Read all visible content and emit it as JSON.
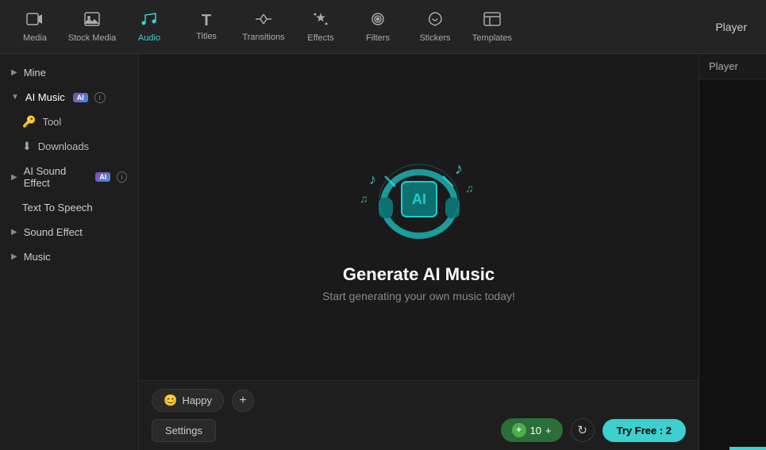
{
  "nav": {
    "items": [
      {
        "id": "media",
        "label": "Media",
        "icon": "🎬",
        "active": false
      },
      {
        "id": "stock-media",
        "label": "Stock Media",
        "icon": "📷",
        "active": false
      },
      {
        "id": "audio",
        "label": "Audio",
        "icon": "♫",
        "active": true
      },
      {
        "id": "titles",
        "label": "Titles",
        "icon": "T",
        "active": false
      },
      {
        "id": "transitions",
        "label": "Transitions",
        "icon": "↔",
        "active": false
      },
      {
        "id": "effects",
        "label": "Effects",
        "icon": "✦",
        "active": false
      },
      {
        "id": "filters",
        "label": "Filters",
        "icon": "◉",
        "active": false
      },
      {
        "id": "stickers",
        "label": "Stickers",
        "icon": "✿",
        "active": false
      },
      {
        "id": "templates",
        "label": "Templates",
        "icon": "⊞",
        "active": false
      }
    ],
    "player_label": "Player"
  },
  "sidebar": {
    "mine_label": "Mine",
    "ai_music_label": "AI Music",
    "tool_label": "Tool",
    "downloads_label": "Downloads",
    "ai_sound_effect_label": "AI Sound Effect",
    "text_to_speech_label": "Text To Speech",
    "sound_effect_label": "Sound Effect",
    "music_label": "Music"
  },
  "content": {
    "title": "Generate AI Music",
    "subtitle": "Start generating your own music today!"
  },
  "bottom": {
    "mood_label": "Happy",
    "add_icon": "+",
    "settings_label": "Settings",
    "credits_value": "10",
    "credits_icon": "+",
    "try_free_label": "Try Free : 2"
  }
}
